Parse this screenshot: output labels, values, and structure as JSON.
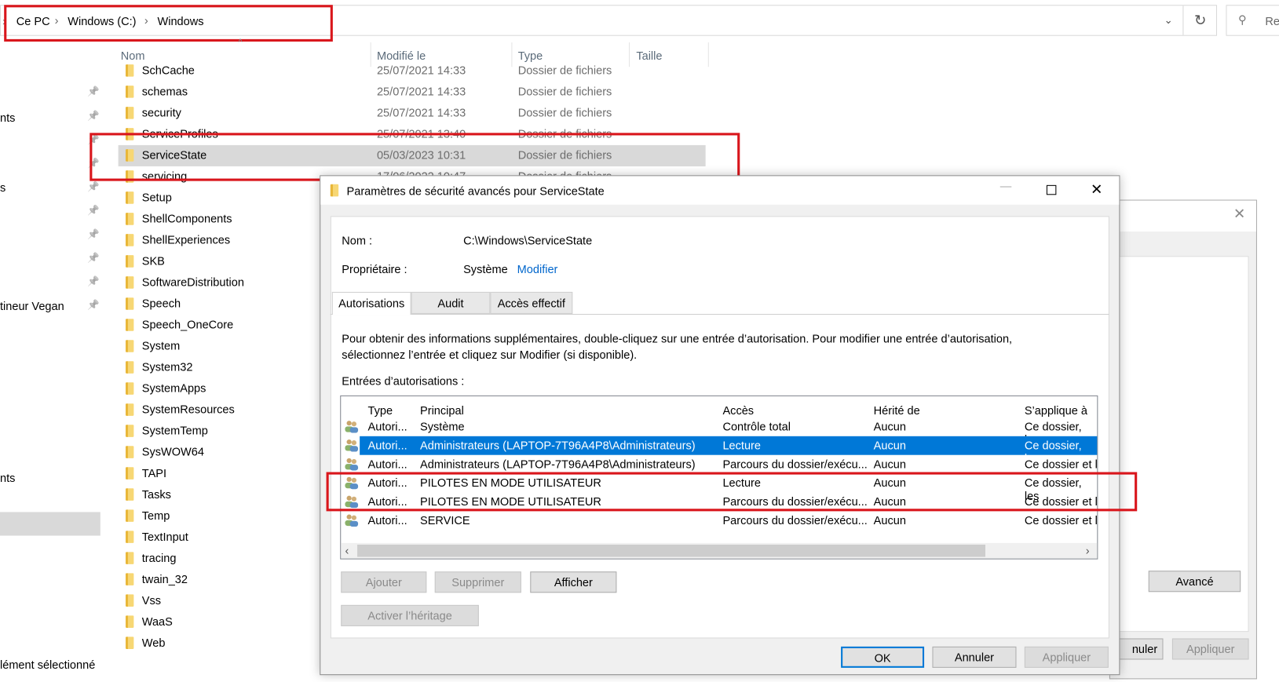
{
  "explorer": {
    "breadcrumb": [
      "Ce PC",
      "Windows (C:)",
      "Windows"
    ],
    "search_placeholder": "Re",
    "columns": [
      "Nom",
      "Modifié le",
      "Type",
      "Taille"
    ],
    "sidebar_fragments": [
      "nts",
      "s",
      "tineur Vegan",
      "nts"
    ],
    "status": "lément sélectionné",
    "rows": [
      {
        "name": "SchCache",
        "date": "25/07/2021 14:33",
        "type": "Dossier de fichiers"
      },
      {
        "name": "schemas",
        "date": "25/07/2021 14:33",
        "type": "Dossier de fichiers"
      },
      {
        "name": "security",
        "date": "25/07/2021 14:33",
        "type": "Dossier de fichiers"
      },
      {
        "name": "ServiceProfiles",
        "date": "25/07/2021 13:40",
        "type": "Dossier de fichiers"
      },
      {
        "name": "ServiceState",
        "date": "05/03/2023 10:31",
        "type": "Dossier de fichiers",
        "selected": true
      },
      {
        "name": "servicing",
        "date": "17/06/2022 10:47",
        "type": "Dossier de fichiers"
      },
      {
        "name": "Setup"
      },
      {
        "name": "ShellComponents"
      },
      {
        "name": "ShellExperiences"
      },
      {
        "name": "SKB"
      },
      {
        "name": "SoftwareDistribution"
      },
      {
        "name": "Speech"
      },
      {
        "name": "Speech_OneCore"
      },
      {
        "name": "System"
      },
      {
        "name": "System32"
      },
      {
        "name": "SystemApps"
      },
      {
        "name": "SystemResources"
      },
      {
        "name": "SystemTemp"
      },
      {
        "name": "SysWOW64"
      },
      {
        "name": "TAPI"
      },
      {
        "name": "Tasks"
      },
      {
        "name": "Temp"
      },
      {
        "name": "TextInput"
      },
      {
        "name": "tracing"
      },
      {
        "name": "twain_32"
      },
      {
        "name": "Vss"
      },
      {
        "name": "WaaS"
      },
      {
        "name": "Web"
      }
    ]
  },
  "background_dialog": {
    "advanced": "Avancé",
    "cancel": "nuler",
    "apply": "Appliquer"
  },
  "dialog": {
    "title": "Paramètres de sécurité avancés pour ServiceState",
    "name_label": "Nom :",
    "name_value": "C:\\Windows\\ServiceState",
    "owner_label": "Propriétaire :",
    "owner_value": "Système",
    "owner_change": "Modifier",
    "tabs": [
      "Autorisations",
      "Audit",
      "Accès effectif"
    ],
    "info": "Pour obtenir des informations supplémentaires, double-cliquez sur une entrée d’autorisation. Pour modifier une entrée d’autorisation,",
    "info2": "sélectionnez l’entrée et cliquez sur Modifier (si disponible).",
    "entries_label": "Entrées d’autorisations :",
    "columns": [
      "Type",
      "Principal",
      "Accès",
      "Hérité de",
      "S’applique à"
    ],
    "entries": [
      {
        "type": "Autori...",
        "principal": "Système",
        "access": "Contrôle total",
        "inherited": "Aucun",
        "applies": "Ce dossier, les"
      },
      {
        "type": "Autori...",
        "principal": "Administrateurs (LAPTOP-7T96A4P8\\Administrateurs)",
        "access": "Lecture",
        "inherited": "Aucun",
        "applies": "Ce dossier, les",
        "selected": true
      },
      {
        "type": "Autori...",
        "principal": "Administrateurs (LAPTOP-7T96A4P8\\Administrateurs)",
        "access": "Parcours du dossier/exécu...",
        "inherited": "Aucun",
        "applies": "Ce dossier et l"
      },
      {
        "type": "Autori...",
        "principal": "PILOTES EN MODE UTILISATEUR",
        "access": "Lecture",
        "inherited": "Aucun",
        "applies": "Ce dossier, les"
      },
      {
        "type": "Autori...",
        "principal": "PILOTES EN MODE UTILISATEUR",
        "access": "Parcours du dossier/exécu...",
        "inherited": "Aucun",
        "applies": "Ce dossier et l"
      },
      {
        "type": "Autori...",
        "principal": "SERVICE",
        "access": "Parcours du dossier/exécu...",
        "inherited": "Aucun",
        "applies": "Ce dossier et l"
      }
    ],
    "buttons": {
      "add": "Ajouter",
      "remove": "Supprimer",
      "view": "Afficher",
      "enable_inheritance": "Activer l’héritage",
      "ok": "OK",
      "cancel": "Annuler",
      "apply": "Appliquer"
    }
  },
  "colors": {
    "highlight": "#0078d7",
    "annotation": "#d9161c",
    "link": "#0066cc"
  }
}
